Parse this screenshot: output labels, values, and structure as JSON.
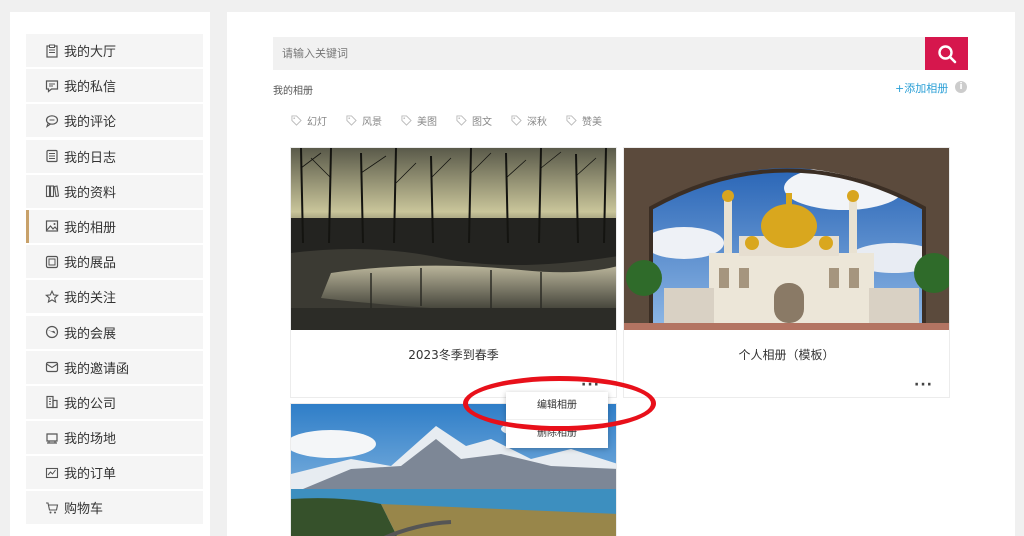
{
  "sidebar": {
    "items": [
      {
        "label": "我的大厅",
        "icon": "clipboard-icon"
      },
      {
        "label": "我的私信",
        "icon": "message-icon"
      },
      {
        "label": "我的评论",
        "icon": "comment-icon"
      },
      {
        "label": "我的日志",
        "icon": "journal-icon"
      },
      {
        "label": "我的资料",
        "icon": "books-icon"
      },
      {
        "label": "我的相册",
        "icon": "image-icon",
        "active": true
      },
      {
        "label": "我的展品",
        "icon": "exhibit-icon"
      },
      {
        "label": "我的关注",
        "icon": "star-icon"
      },
      {
        "label": "我的会展",
        "icon": "globe-icon"
      },
      {
        "label": "我的邀请函",
        "icon": "envelope-icon"
      },
      {
        "label": "我的公司",
        "icon": "building-icon"
      },
      {
        "label": "我的场地",
        "icon": "venue-icon"
      },
      {
        "label": "我的订单",
        "icon": "order-icon"
      },
      {
        "label": "购物车",
        "icon": "cart-icon"
      }
    ]
  },
  "search": {
    "placeholder": "请输入关键词",
    "icon": "search-icon"
  },
  "section": {
    "title": "我的相册",
    "add_label": "+添加相册",
    "info": "i"
  },
  "tags": [
    "幻灯",
    "风景",
    "美图",
    "图文",
    "深秋",
    "赞美"
  ],
  "albums": [
    {
      "title": "2023冬季到春季",
      "more": "···"
    },
    {
      "title": "个人相册（模板）",
      "more": "···"
    },
    {
      "title": "",
      "more": ""
    }
  ],
  "dropdown": {
    "edit": "编辑相册",
    "delete": "删除相册"
  },
  "colors": {
    "accent": "#d6174d",
    "link": "#2a9fd6",
    "active_border": "#c8a16a",
    "highlight": "#e8101a"
  }
}
